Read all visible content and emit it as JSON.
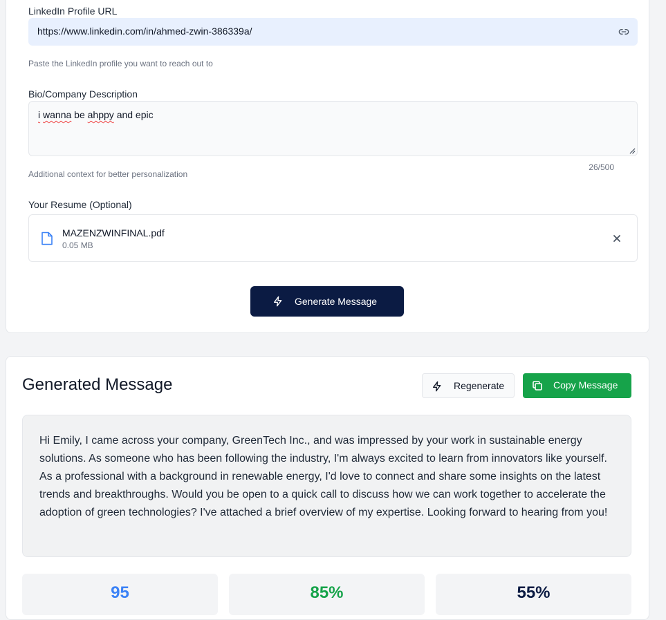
{
  "form": {
    "linkedin_label": "LinkedIn Profile URL",
    "linkedin_value": "https://www.linkedin.com/in/ahmed-zwin-386339a/",
    "linkedin_hint": "Paste the LinkedIn profile you want to reach out to",
    "bio_label": "Bio/Company Description",
    "bio_word1": "i",
    "bio_word2": "wanna",
    "bio_word3": "be",
    "bio_word4": "ahppy",
    "bio_word5": "and epic",
    "bio_hint": "Additional context for better personalization",
    "bio_counter": "26/500",
    "resume_label": "Your Resume (Optional)",
    "file_name": "MAZENZWINFINAL.pdf",
    "file_size": "0.05 MB",
    "generate_label": "Generate Message"
  },
  "result": {
    "title": "Generated Message",
    "regenerate_label": "Regenerate",
    "copy_label": "Copy Message",
    "message": "Hi Emily, I came across your company, GreenTech Inc., and was impressed by your work in sustainable energy solutions. As someone who has been following the industry, I'm always excited to learn from innovators like yourself. As a professional with a background in renewable energy, I'd love to connect and share some insights on the latest trends and breakthroughs. Would you be open to a quick call to discuss how we can work together to accelerate the adoption of green technologies? I've attached a brief overview of my expertise. Looking forward to hearing from you!"
  },
  "stats": [
    {
      "value": "95",
      "color": "#3b82f6"
    },
    {
      "value": "85%",
      "color": "#16a34a"
    },
    {
      "value": "55%",
      "color": "#0b1b43"
    }
  ],
  "icons": {
    "url_field": "link-icon",
    "file": "document-icon",
    "remove": "close-icon",
    "generate": "lightning-icon",
    "regenerate": "lightning-icon",
    "copy": "copy-icon"
  }
}
